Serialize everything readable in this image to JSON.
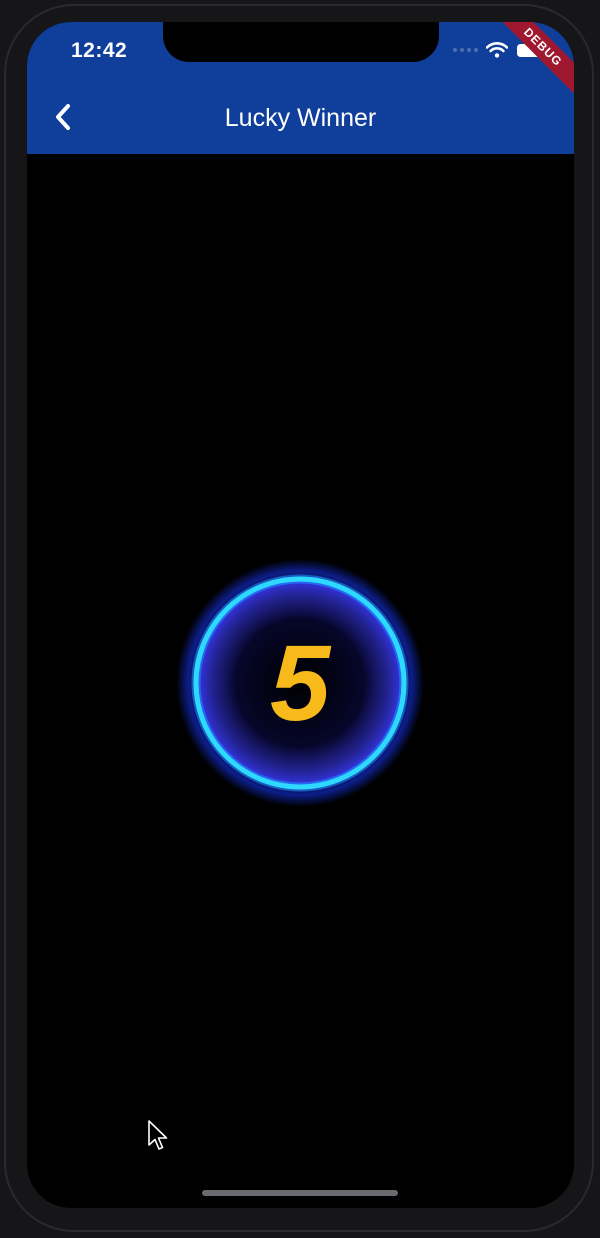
{
  "status_bar": {
    "time": "12:42",
    "signal_icon": "signal-dots-icon",
    "wifi_icon": "wifi-icon",
    "battery_icon": "battery-icon"
  },
  "debug_banner": {
    "label": "DEBUG"
  },
  "app_bar": {
    "title": "Lucky Winner",
    "back_icon": "chevron-left-icon",
    "background_color": "#0f3f9a"
  },
  "counter": {
    "value": "5",
    "number_color": "#f8b91a",
    "ring_color": "#2fd8ff",
    "glow_color": "#3b3bff"
  }
}
